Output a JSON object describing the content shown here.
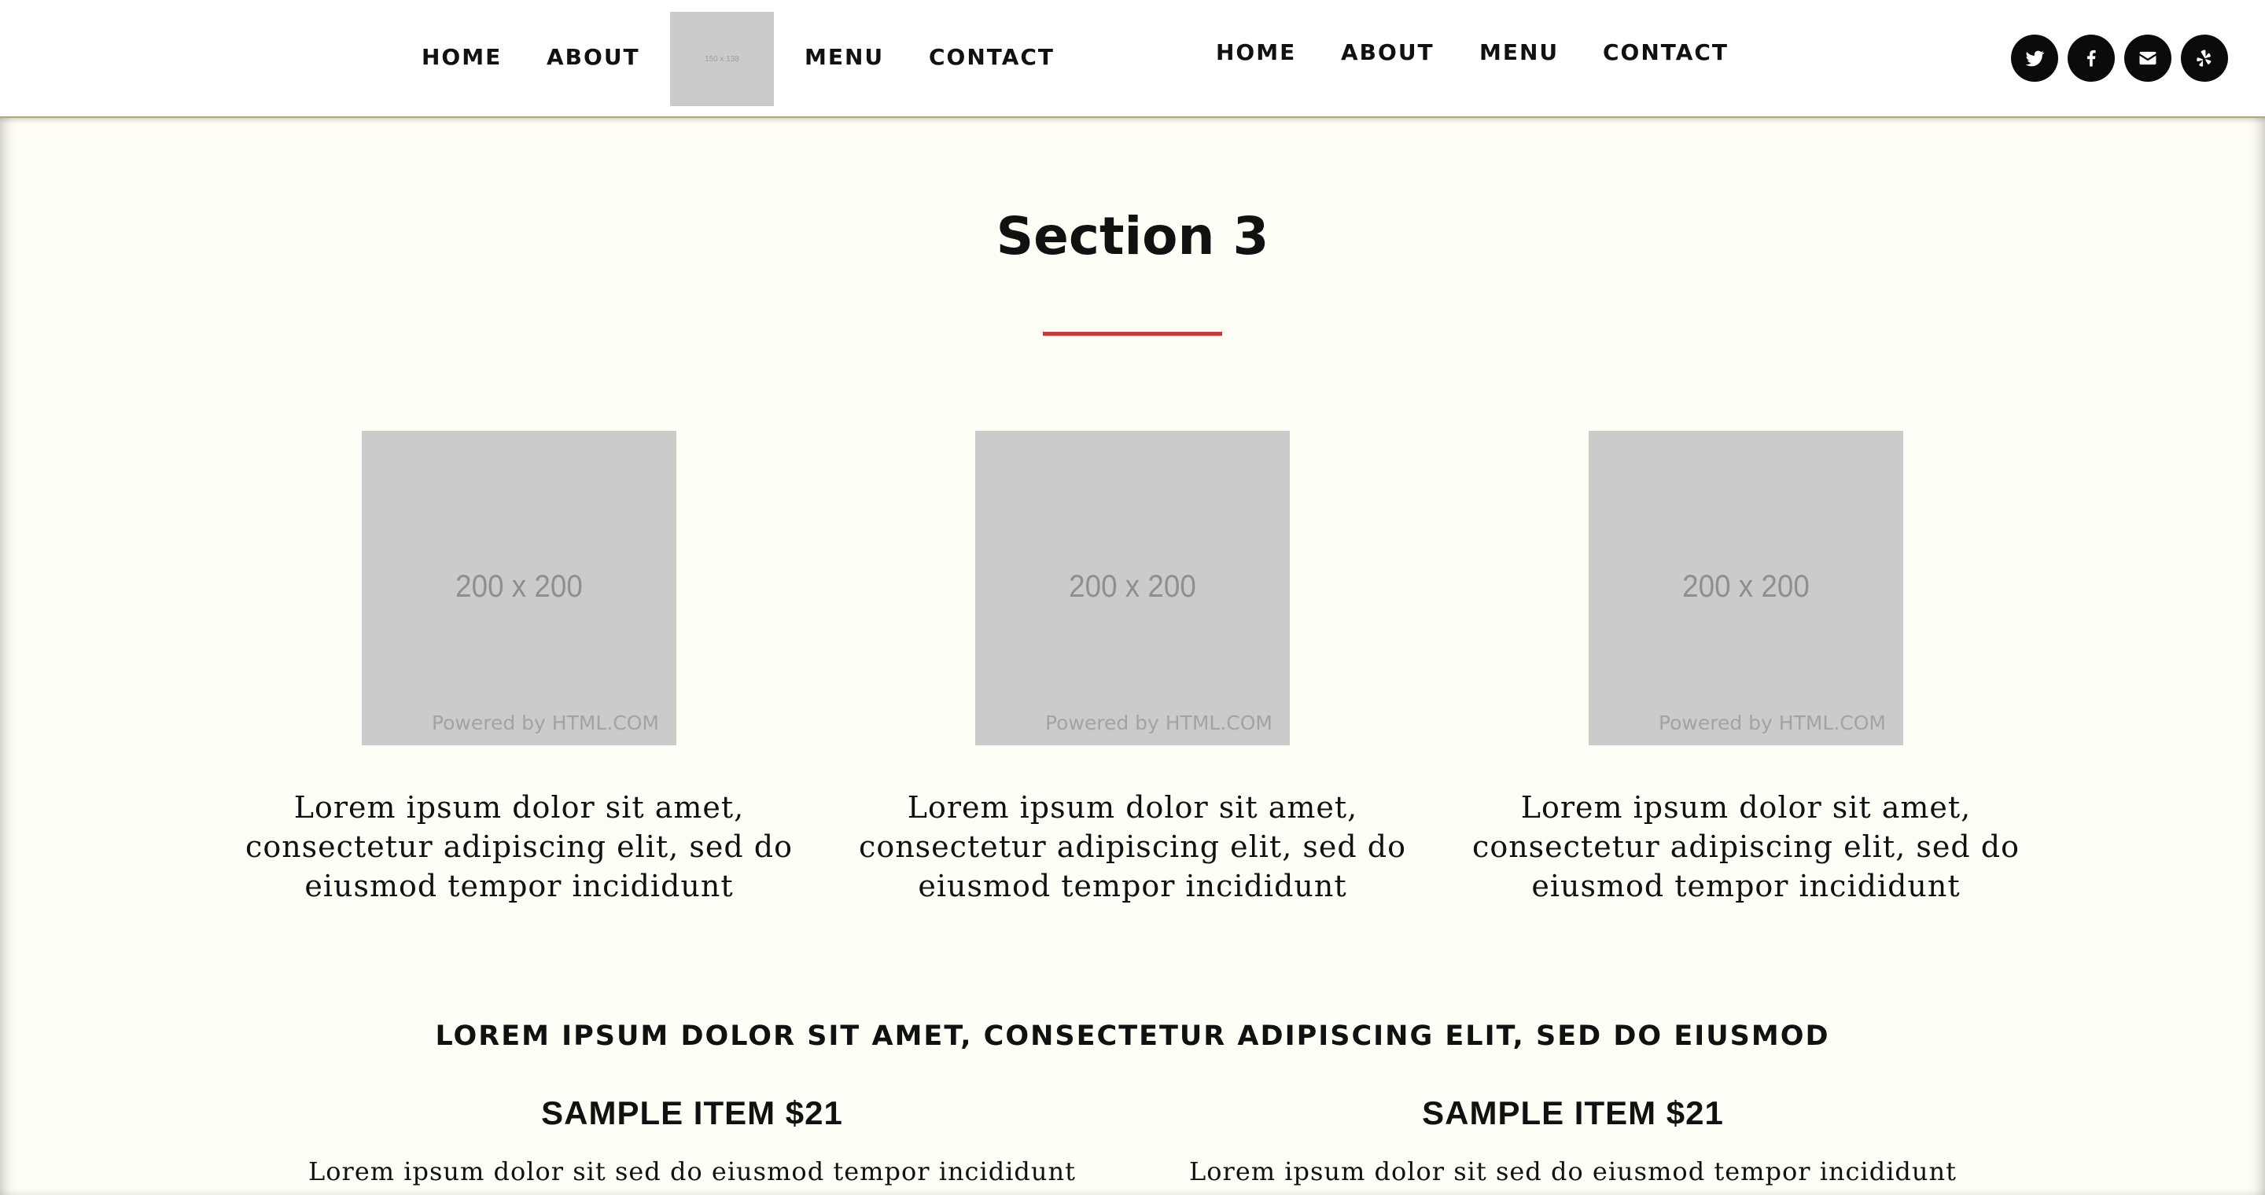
{
  "header": {
    "left_nav": [
      "HOME",
      "ABOUT",
      "MENU",
      "CONTACT"
    ],
    "logo_text": "150 x 138",
    "right_nav": [
      "HOME",
      "ABOUT",
      "MENU",
      "CONTACT"
    ],
    "social_icons": [
      "twitter-icon",
      "facebook-icon",
      "email-icon",
      "yelp-icon"
    ]
  },
  "section": {
    "title": "Section 3",
    "accent_color": "#c93a3a",
    "cards": [
      {
        "image_text": "200 x 200",
        "powered_text": "Powered by HTML.COM",
        "text": "Lorem ipsum dolor sit amet, consectetur adipiscing elit, sed do eiusmod tempor incididunt"
      },
      {
        "image_text": "200 x 200",
        "powered_text": "Powered by HTML.COM",
        "text": "Lorem ipsum dolor sit amet, consectetur adipiscing elit, sed do eiusmod tempor incididunt"
      },
      {
        "image_text": "200 x 200",
        "powered_text": "Powered by HTML.COM",
        "text": "Lorem ipsum dolor sit amet, consectetur adipiscing elit, sed do eiusmod tempor incididunt"
      }
    ],
    "headline": "LOREM IPSUM DOLOR SIT AMET, CONSECTETUR ADIPISCING ELIT, SED DO EIUSMOD",
    "items": [
      {
        "title": "SAMPLE ITEM $21",
        "desc": "Lorem ipsum dolor sit sed do eiusmod tempor incididunt"
      },
      {
        "title": "SAMPLE ITEM $21",
        "desc": "Lorem ipsum dolor sit sed do eiusmod tempor incididunt"
      }
    ]
  }
}
